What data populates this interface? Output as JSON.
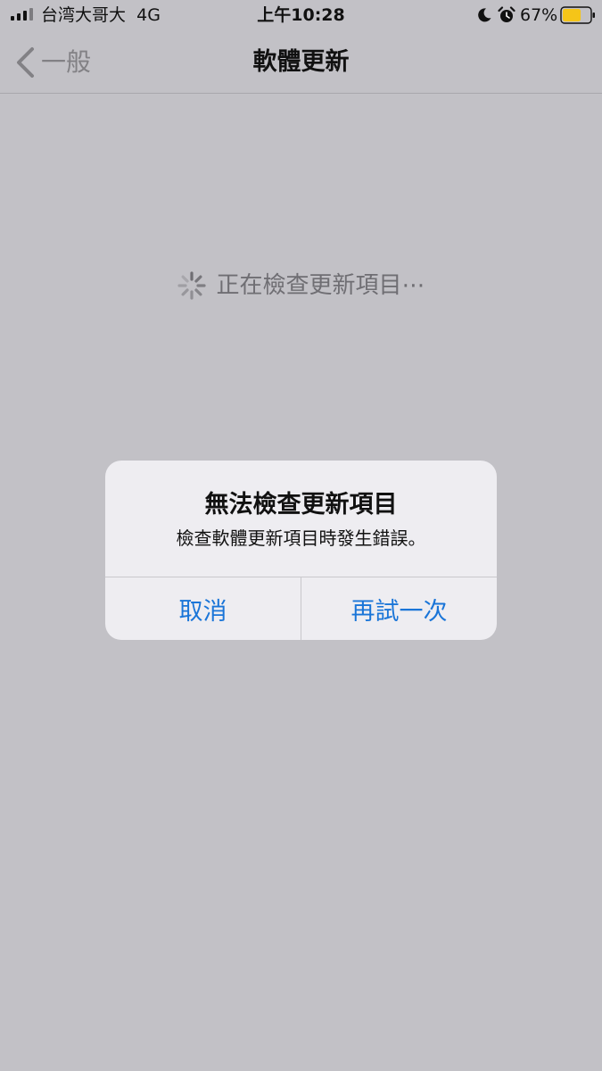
{
  "status_bar": {
    "carrier": "台湾大哥大",
    "network": "4G",
    "time": "上午10:28",
    "battery_percent": "67%",
    "battery_level": 0.67,
    "battery_color": "#f5c518",
    "icons": [
      "signal-icon",
      "moon-icon",
      "alarm-icon",
      "battery-icon"
    ]
  },
  "nav": {
    "back_label": "一般",
    "title": "軟體更新"
  },
  "loading": {
    "text": "正在檢查更新項目⋯"
  },
  "alert": {
    "title": "無法檢查更新項目",
    "message": "檢查軟體更新項目時發生錯誤。",
    "cancel_label": "取消",
    "retry_label": "再試一次",
    "accent_color": "#1a75d8"
  }
}
